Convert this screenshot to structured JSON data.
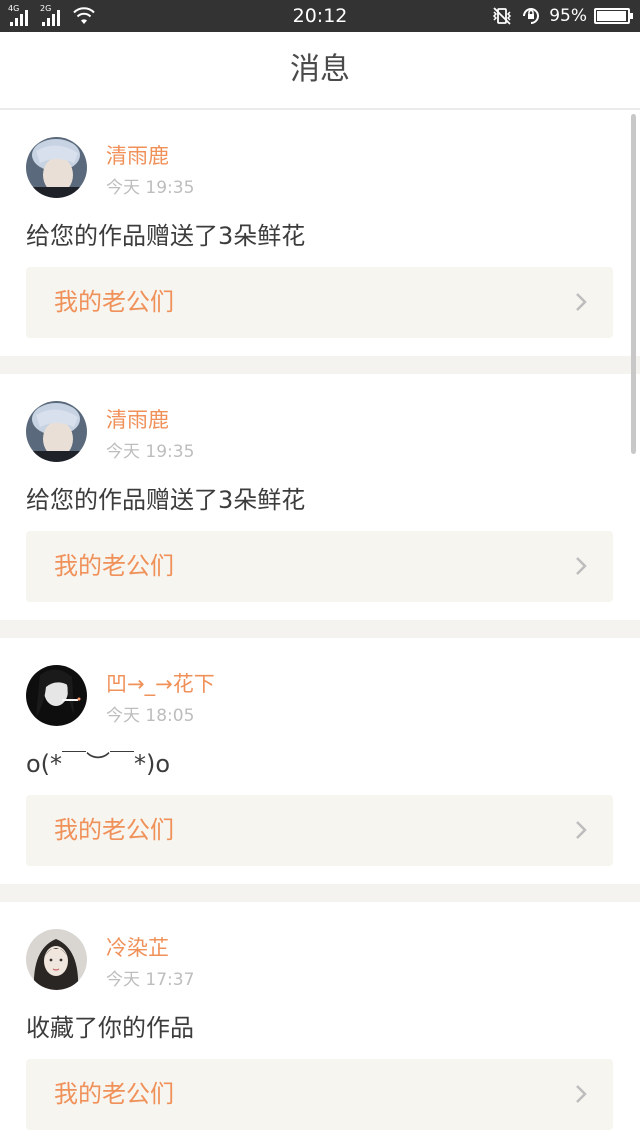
{
  "status_bar": {
    "network_1": "4G",
    "network_2": "2G",
    "time": "20:12",
    "battery_percent": "95%",
    "battery_level": 0.95,
    "icons": [
      "signal-icon",
      "signal-icon",
      "wifi-icon",
      "vibrate-icon",
      "rotation-lock-icon",
      "battery-icon"
    ]
  },
  "header": {
    "title": "消息"
  },
  "messages": [
    {
      "username": "清雨鹿",
      "time": "今天 19:35",
      "text": "给您的作品赠送了3朵鲜花",
      "work_title": "我的老公们"
    },
    {
      "username": "清雨鹿",
      "time": "今天 19:35",
      "text": "给您的作品赠送了3朵鲜花",
      "work_title": "我的老公们"
    },
    {
      "username": "凹→_→花下",
      "time": "今天 18:05",
      "text": "o(*￣︶￣*)o",
      "work_title": "我的老公们"
    },
    {
      "username": "冷染芷",
      "time": "今天 17:37",
      "text": "收藏了你的作品",
      "work_title": "我的老公们"
    }
  ],
  "colors": {
    "accent": "#f0915a",
    "status_bar": "#333333",
    "card_link_bg": "#f6f5f0",
    "divider": "#f5f3ef",
    "timestamp": "#bdbdbd"
  }
}
